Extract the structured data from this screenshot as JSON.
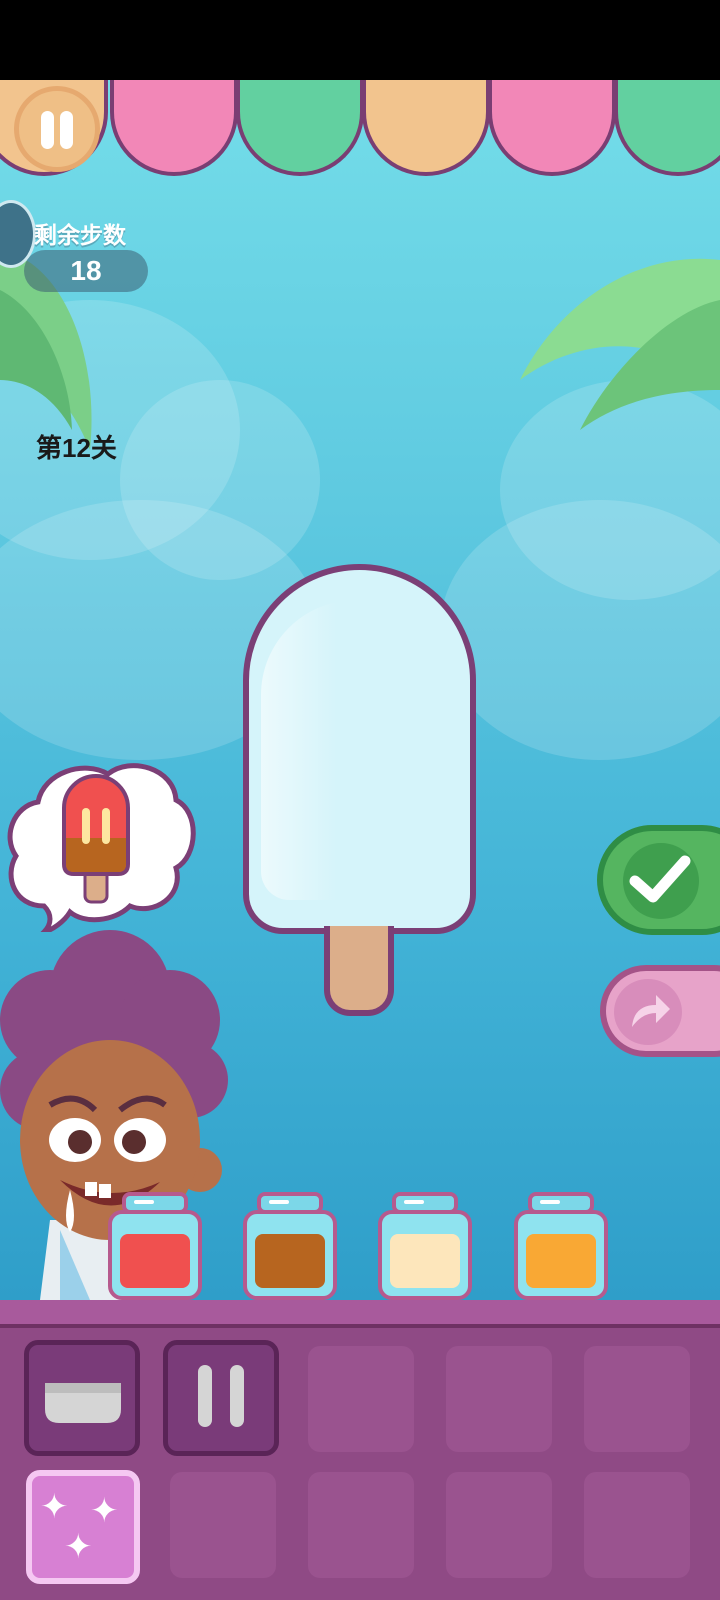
{
  "hud": {
    "moves_label": "剩余步数",
    "moves_value": "18",
    "level": "第12关"
  },
  "colors": {
    "awning": [
      "#f2c48e",
      "#f287b7",
      "#62d0a0",
      "#f2c48e",
      "#f287b7",
      "#62d0a0"
    ],
    "jars": [
      "#f0504f",
      "#b7651f",
      "#fde6bb",
      "#f9a834"
    ],
    "popsicle_body": "#d5f4fa",
    "confirm_button": "#55b560",
    "skip_button": "#e7a3c9"
  },
  "order": {
    "description_icon": "popsicle-icon",
    "target_flavors": [
      "strawberry-red",
      "chocolate-brown"
    ]
  },
  "buttons": {
    "pause_icon": "pause-icon",
    "confirm_icon": "check-icon",
    "skip_icon": "share-arrow-icon"
  },
  "jars": [
    {
      "flavor": "red"
    },
    {
      "flavor": "brown"
    },
    {
      "flavor": "cream"
    },
    {
      "flavor": "orange"
    }
  ],
  "tools": [
    {
      "icon": "mold-icon",
      "active": true
    },
    {
      "icon": "stripes-icon",
      "active": true
    },
    {
      "icon": "empty-slot",
      "active": false
    },
    {
      "icon": "empty-slot",
      "active": false
    },
    {
      "icon": "empty-slot",
      "active": false
    },
    {
      "icon": "sparkle-icon",
      "active": true
    },
    {
      "icon": "empty-slot",
      "active": false
    },
    {
      "icon": "empty-slot",
      "active": false
    },
    {
      "icon": "empty-slot",
      "active": false
    },
    {
      "icon": "empty-slot",
      "active": false
    }
  ]
}
